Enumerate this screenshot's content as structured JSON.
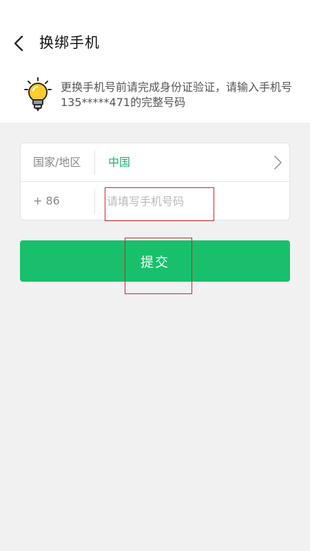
{
  "header": {
    "title": "换绑手机",
    "back_icon": "chevron-left-icon"
  },
  "tip": {
    "icon": "lightbulb-icon",
    "text": "更换手机号前请完成身份证验证，请输入手机号135*****471的完整号码"
  },
  "form": {
    "country_label": "国家/地区",
    "country_value": "中国",
    "country_chevron_icon": "chevron-right-icon",
    "code_label": "+ 86",
    "phone_placeholder": "请填写手机号码",
    "phone_value": ""
  },
  "actions": {
    "submit_label": "提交"
  },
  "colors": {
    "accent": "#19c06b",
    "accent_text": "#1aad6a",
    "highlight_box": "#c0292b",
    "background": "#f1f1f1"
  }
}
